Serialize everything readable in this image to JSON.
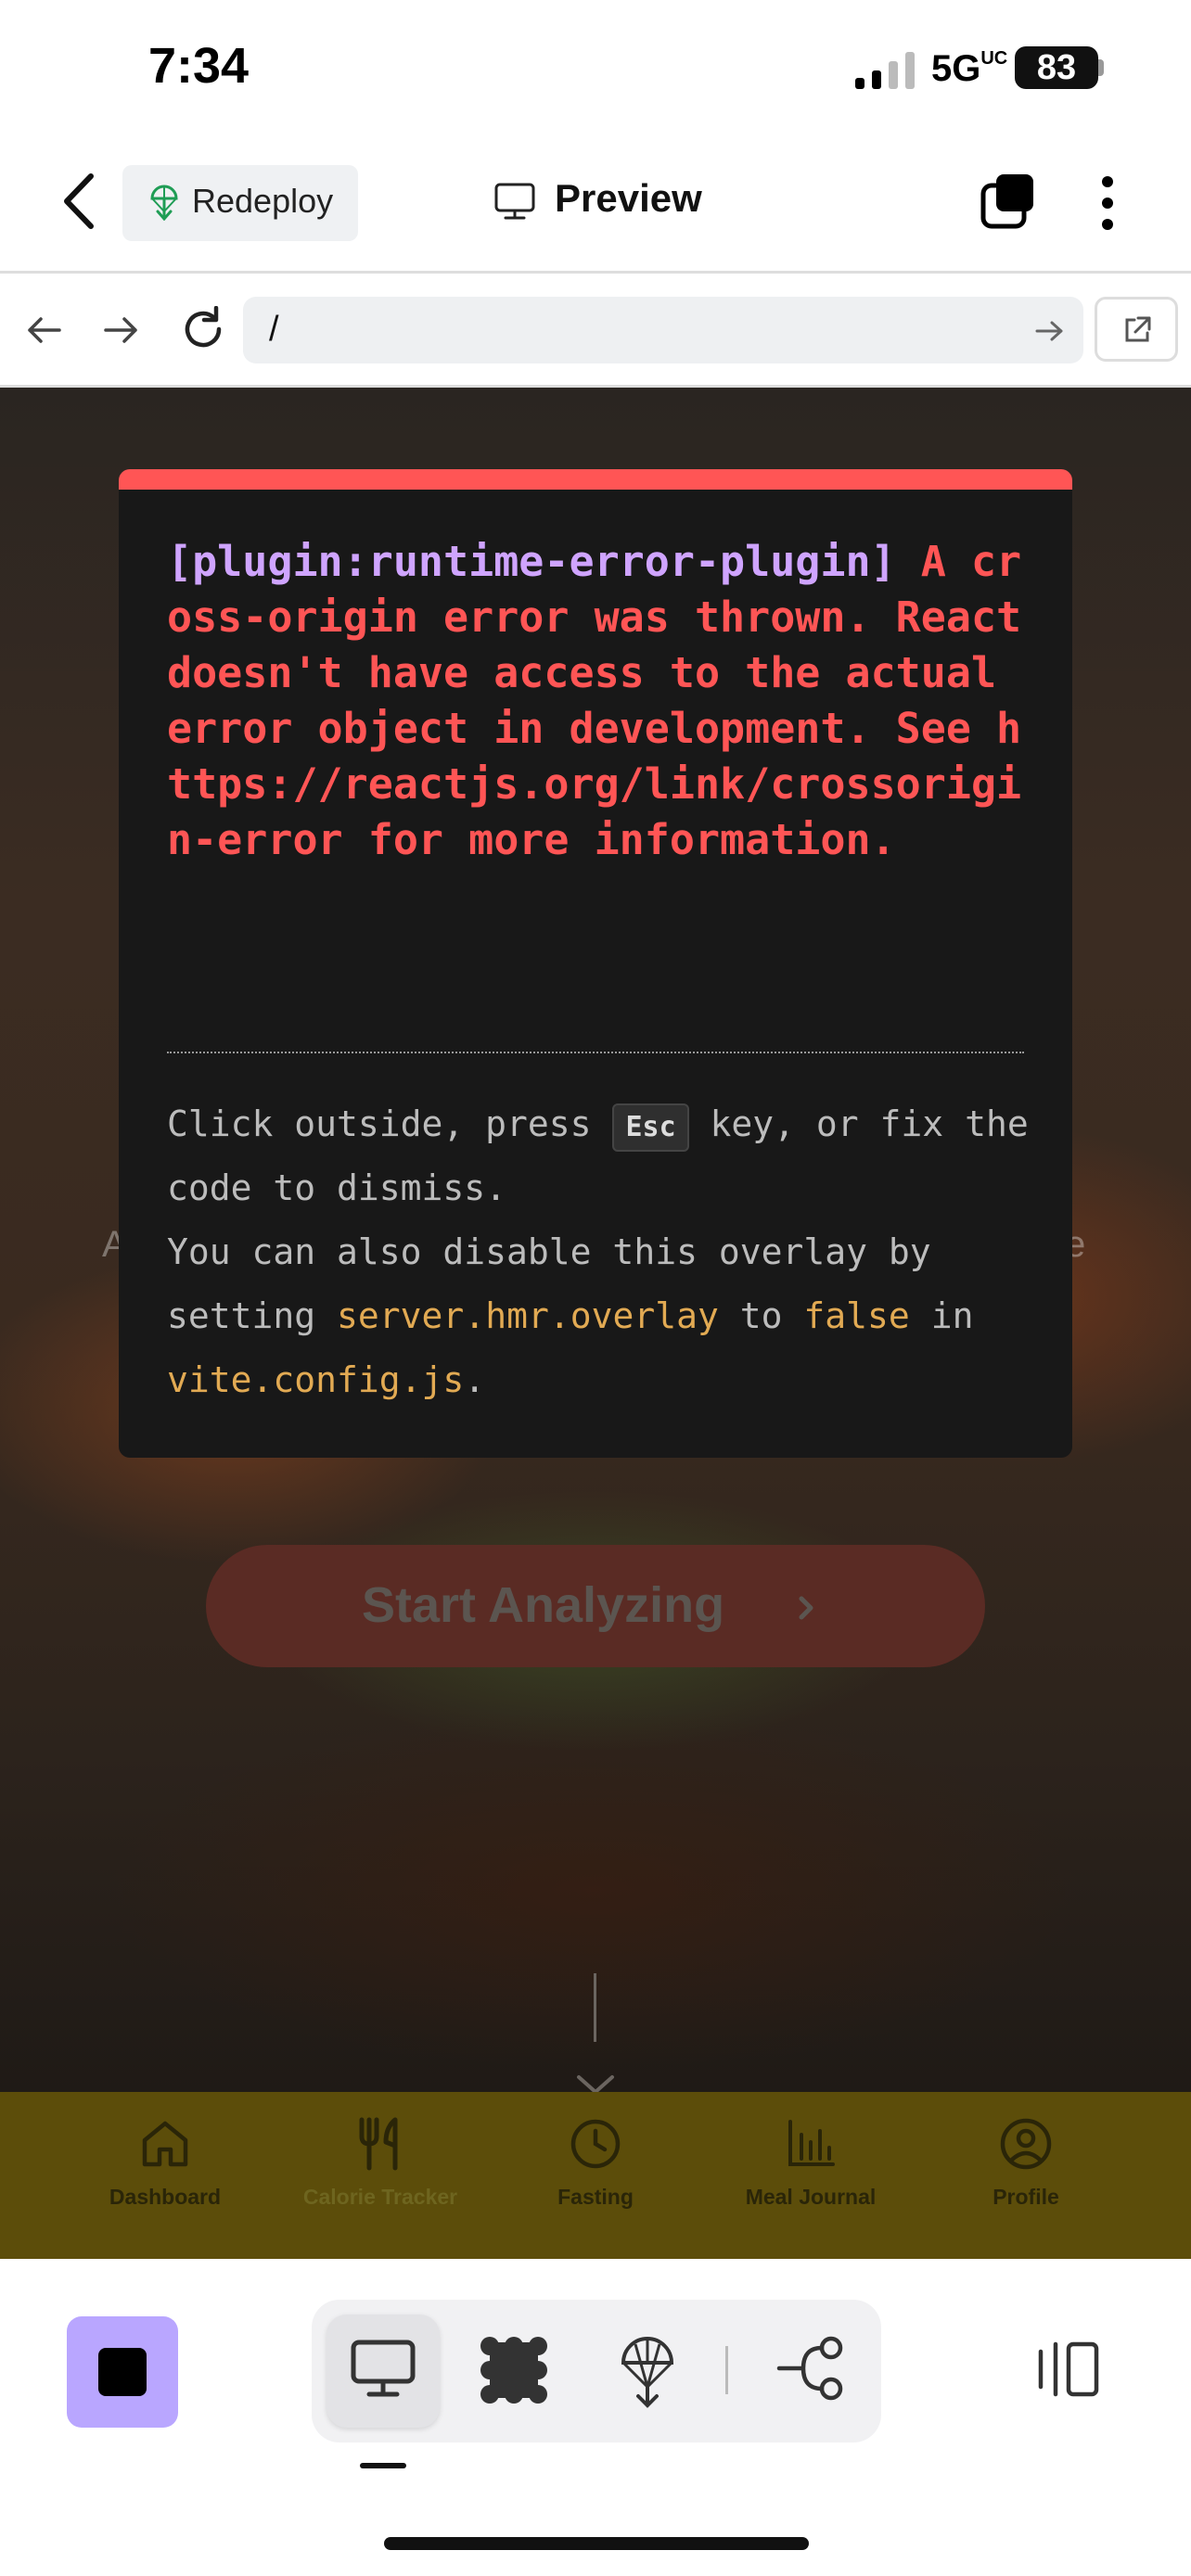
{
  "status_bar": {
    "time": "7:34",
    "network": "5G",
    "network_suffix": "UC",
    "battery": "83"
  },
  "header": {
    "redeploy_label": "Redeploy",
    "title": "Preview"
  },
  "browser": {
    "url": "/"
  },
  "app": {
    "start_button": "Start Analyzing",
    "faded_left": "A",
    "faded_right": "e",
    "nav": [
      {
        "label": "Dashboard",
        "icon": "home-icon"
      },
      {
        "label": "Calorie Tracker",
        "icon": "utensils-icon"
      },
      {
        "label": "Fasting",
        "icon": "clock-icon"
      },
      {
        "label": "Meal Journal",
        "icon": "bar-chart-icon"
      },
      {
        "label": "Profile",
        "icon": "user-circle-icon"
      }
    ]
  },
  "error_overlay": {
    "plugin": "[plugin:runtime-error-plugin]",
    "message": "A cross-origin error was thrown. React doesn't have access to the actual error object in development. See https://reactjs.org/link/crossorigin-error for more information.",
    "tip_1": "Click outside, press",
    "esc_key": "Esc",
    "tip_2": "key, or fix the code to dismiss.",
    "tip_3": "You can also disable this overlay by setting",
    "setting": "server.hmr.overlay",
    "tip_4": "to",
    "value": "false",
    "tip_5": "in",
    "config_file": "vite.config.js",
    "tip_6": "."
  },
  "colors": {
    "accent_error": "#ff5555",
    "plugin": "#cfa4ff",
    "code": "#e2aa53",
    "stop_button": "#b9a6ff",
    "app_nav": "#5c4d0a"
  }
}
